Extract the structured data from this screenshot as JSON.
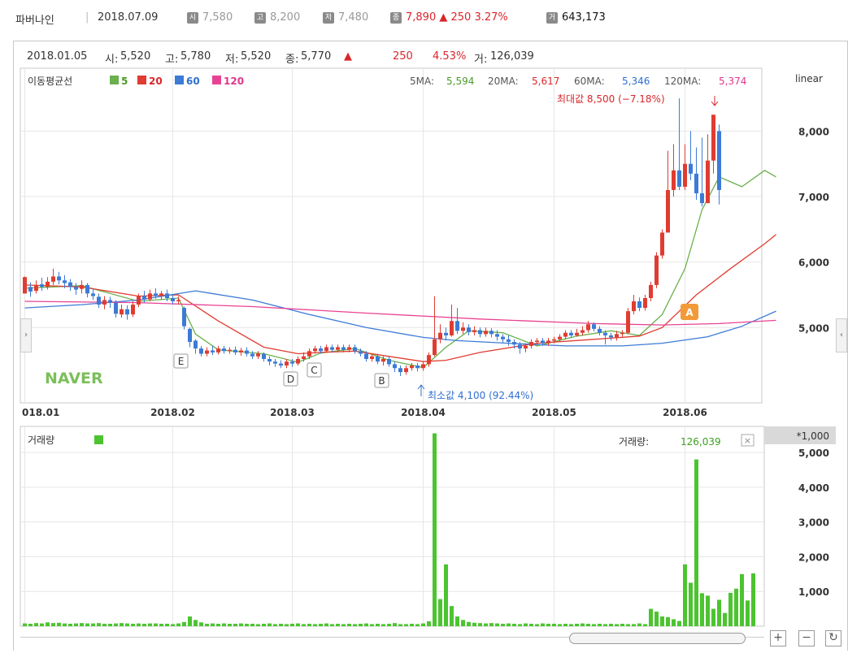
{
  "header": {
    "stock_name": "파버나인",
    "date": "2018.07.09",
    "open_badge": "시",
    "open_value": "7,580",
    "high_badge": "고",
    "high_value": "8,200",
    "low_badge": "저",
    "low_value": "7,480",
    "close_badge": "종",
    "close_value": "7,890",
    "change_value": "▲ 250",
    "change_rate": "3.27%",
    "volume_badge": "거",
    "volume_value": "643,173"
  },
  "info": {
    "date": "2018.01.05",
    "open_label": "시:",
    "open": "5,520",
    "high_label": "고:",
    "high": "5,780",
    "low_label": "저:",
    "low": "5,520",
    "close_label": "종:",
    "close": "5,770",
    "arrow": "▲",
    "change": "250",
    "rate": "4.53%",
    "volume_label": "거:",
    "volume": "126,039"
  },
  "ma_legend": {
    "title": "이동평균선",
    "items": [
      {
        "period": "5",
        "color": "#6ab04c"
      },
      {
        "period": "20",
        "color": "#e03c31"
      },
      {
        "period": "60",
        "color": "#3c7bd6"
      },
      {
        "period": "120",
        "color": "#e84393"
      }
    ]
  },
  "ma_values": [
    {
      "label": "5MA:",
      "value": "5,594",
      "color": "#4a9a2a"
    },
    {
      "label": "20MA:",
      "value": "5,617",
      "color": "#d9262b"
    },
    {
      "label": "60MA:",
      "value": "5,346",
      "color": "#2f6fd0"
    },
    {
      "label": "120MA:",
      "value": "5,374",
      "color": "#e0368a"
    }
  ],
  "scale_mode": "linear",
  "max_annotation": "최대값 8,500 (−7.18%)",
  "min_annotation": "최소값 4,100 (92.44%)",
  "watermark": "NAVER",
  "volume_panel": {
    "title": "거래량",
    "readout_label": "거래량:",
    "readout_value": "126,039",
    "unit_label": "*1,000",
    "close_icon": "×"
  },
  "event_markers": [
    "E",
    "D",
    "C",
    "B",
    "A"
  ],
  "chart_data": [
    {
      "type": "candlestick",
      "x_ticks": [
        "018.01",
        "2018.02",
        "2018.03",
        "2018.04",
        "2018.05",
        "2018.06"
      ],
      "y_ticks": [
        5000,
        6000,
        7000,
        8000
      ],
      "ylim": [
        3850,
        8960
      ],
      "colors": {
        "up": "#e03c31",
        "down": "#3c7bd6"
      },
      "candles": [
        [
          5520,
          5770,
          5780,
          5520
        ],
        [
          5620,
          5550,
          5690,
          5470
        ],
        [
          5560,
          5650,
          5720,
          5520
        ],
        [
          5660,
          5620,
          5760,
          5560
        ],
        [
          5620,
          5700,
          5770,
          5580
        ],
        [
          5700,
          5780,
          5900,
          5650
        ],
        [
          5780,
          5720,
          5850,
          5660
        ],
        [
          5720,
          5680,
          5800,
          5600
        ],
        [
          5690,
          5620,
          5740,
          5560
        ],
        [
          5620,
          5580,
          5680,
          5500
        ],
        [
          5590,
          5650,
          5720,
          5520
        ],
        [
          5650,
          5520,
          5680,
          5460
        ],
        [
          5520,
          5480,
          5600,
          5420
        ],
        [
          5470,
          5350,
          5520,
          5300
        ],
        [
          5350,
          5420,
          5480,
          5280
        ],
        [
          5420,
          5380,
          5470,
          5300
        ],
        [
          5380,
          5210,
          5420,
          5150
        ],
        [
          5200,
          5280,
          5350,
          5150
        ],
        [
          5280,
          5200,
          5340,
          5120
        ],
        [
          5200,
          5350,
          5400,
          5160
        ],
        [
          5350,
          5480,
          5520,
          5310
        ],
        [
          5480,
          5430,
          5560,
          5380
        ],
        [
          5430,
          5520,
          5580,
          5400
        ],
        [
          5520,
          5480,
          5600,
          5440
        ],
        [
          5480,
          5520,
          5560,
          5420
        ],
        [
          5520,
          5450,
          5580,
          5400
        ],
        [
          5450,
          5400,
          5500,
          5350
        ],
        [
          5400,
          5420,
          5480,
          5350
        ],
        [
          5300,
          5020,
          5320,
          4970
        ],
        [
          4980,
          4780,
          5000,
          4700
        ],
        [
          4800,
          4680,
          4820,
          4600
        ],
        [
          4680,
          4600,
          4720,
          4560
        ],
        [
          4600,
          4650,
          4700,
          4560
        ],
        [
          4650,
          4620,
          4720,
          4580
        ],
        [
          4620,
          4680,
          4720,
          4590
        ],
        [
          4680,
          4640,
          4720,
          4600
        ],
        [
          4640,
          4660,
          4700,
          4600
        ],
        [
          4660,
          4620,
          4710,
          4580
        ],
        [
          4620,
          4650,
          4690,
          4570
        ],
        [
          4650,
          4600,
          4700,
          4560
        ],
        [
          4600,
          4560,
          4640,
          4520
        ],
        [
          4560,
          4600,
          4640,
          4520
        ],
        [
          4600,
          4520,
          4620,
          4480
        ],
        [
          4520,
          4480,
          4560,
          4420
        ],
        [
          4480,
          4450,
          4520,
          4400
        ],
        [
          4450,
          4420,
          4500,
          4380
        ],
        [
          4420,
          4480,
          4520,
          4380
        ],
        [
          4480,
          4450,
          4520,
          4400
        ],
        [
          4450,
          4520,
          4560,
          4420
        ],
        [
          4520,
          4560,
          4620,
          4480
        ],
        [
          4560,
          4640,
          4680,
          4520
        ],
        [
          4640,
          4680,
          4720,
          4600
        ],
        [
          4680,
          4640,
          4720,
          4600
        ],
        [
          4640,
          4700,
          4740,
          4620
        ],
        [
          4700,
          4660,
          4740,
          4620
        ],
        [
          4660,
          4700,
          4740,
          4640
        ],
        [
          4700,
          4660,
          4740,
          4620
        ],
        [
          4660,
          4700,
          4740,
          4620
        ],
        [
          4700,
          4640,
          4740,
          4600
        ],
        [
          4640,
          4600,
          4680,
          4560
        ],
        [
          4600,
          4520,
          4640,
          4480
        ],
        [
          4520,
          4560,
          4600,
          4480
        ],
        [
          4560,
          4480,
          4600,
          4440
        ],
        [
          4480,
          4520,
          4560,
          4420
        ],
        [
          4520,
          4440,
          4560,
          4400
        ],
        [
          4440,
          4380,
          4480,
          4320
        ],
        [
          4380,
          4320,
          4420,
          4260
        ],
        [
          4320,
          4380,
          4420,
          4280
        ],
        [
          4380,
          4420,
          4460,
          4340
        ],
        [
          4420,
          4380,
          4460,
          4330
        ],
        [
          4380,
          4440,
          4480,
          4340
        ],
        [
          4440,
          4580,
          4620,
          4400
        ],
        [
          4580,
          4820,
          5480,
          4560
        ],
        [
          4820,
          4920,
          5050,
          4760
        ],
        [
          4920,
          4880,
          5000,
          4800
        ],
        [
          4880,
          5100,
          5350,
          4860
        ],
        [
          5100,
          4950,
          5300,
          4900
        ],
        [
          4950,
          5000,
          5080,
          4900
        ],
        [
          5000,
          4930,
          5050,
          4880
        ],
        [
          4930,
          4960,
          5020,
          4880
        ],
        [
          4960,
          4900,
          5000,
          4850
        ],
        [
          4900,
          4950,
          5000,
          4860
        ],
        [
          4950,
          4900,
          4990,
          4850
        ],
        [
          4900,
          4860,
          4960,
          4800
        ],
        [
          4860,
          4820,
          4900,
          4770
        ],
        [
          4820,
          4780,
          4880,
          4720
        ],
        [
          4780,
          4740,
          4820,
          4680
        ],
        [
          4740,
          4680,
          4780,
          4600
        ],
        [
          4680,
          4720,
          4760,
          4620
        ],
        [
          4720,
          4780,
          4820,
          4680
        ],
        [
          4780,
          4800,
          4840,
          4740
        ],
        [
          4800,
          4760,
          4840,
          4720
        ],
        [
          4760,
          4800,
          4840,
          4720
        ],
        [
          4800,
          4820,
          4860,
          4760
        ],
        [
          4820,
          4860,
          4900,
          4780
        ],
        [
          4860,
          4920,
          4960,
          4820
        ],
        [
          4920,
          4880,
          4960,
          4840
        ],
        [
          4880,
          4920,
          4980,
          4860
        ],
        [
          4920,
          4960,
          5020,
          4880
        ],
        [
          4960,
          5050,
          5100,
          4920
        ],
        [
          5050,
          4980,
          5080,
          4940
        ],
        [
          4980,
          4920,
          5020,
          4880
        ],
        [
          4920,
          4880,
          4960,
          4740
        ],
        [
          4880,
          4850,
          4920,
          4800
        ],
        [
          4850,
          4900,
          4950,
          4800
        ],
        [
          4900,
          4920,
          4960,
          4860
        ],
        [
          4920,
          5250,
          5300,
          4900
        ],
        [
          5250,
          5400,
          5500,
          5200
        ],
        [
          5400,
          5300,
          5460,
          5250
        ],
        [
          5300,
          5450,
          5500,
          5260
        ],
        [
          5450,
          5650,
          5700,
          5400
        ],
        [
          5650,
          6100,
          6150,
          5600
        ],
        [
          6100,
          6450,
          6500,
          6050
        ],
        [
          6450,
          7100,
          7700,
          6950
        ],
        [
          7100,
          7400,
          7800,
          7000
        ],
        [
          7400,
          7150,
          8500,
          7100
        ],
        [
          7150,
          7500,
          7800,
          7100
        ],
        [
          7500,
          7350,
          8000,
          7250
        ],
        [
          7350,
          7050,
          7750,
          6950
        ],
        [
          7050,
          6900,
          7900,
          6850
        ],
        [
          6900,
          7550,
          7950,
          6900
        ],
        [
          7550,
          8250,
          8250,
          7350
        ],
        [
          8000,
          7100,
          8100,
          6880
        ]
      ],
      "ma_lines": [
        {
          "name": "5",
          "color": "#6ab04c",
          "points": [
            [
              0,
              5600
            ],
            [
              10,
              5640
            ],
            [
              20,
              5400
            ],
            [
              27,
              5450
            ],
            [
              30,
              4900
            ],
            [
              34,
              4660
            ],
            [
              42,
              4600
            ],
            [
              48,
              4470
            ],
            [
              52,
              4610
            ],
            [
              58,
              4680
            ],
            [
              64,
              4500
            ],
            [
              70,
              4390
            ],
            [
              74,
              4700
            ],
            [
              78,
              4950
            ],
            [
              84,
              4920
            ],
            [
              90,
              4720
            ],
            [
              97,
              4870
            ],
            [
              103,
              4950
            ],
            [
              108,
              4880
            ],
            [
              112,
              5200
            ],
            [
              116,
              5900
            ],
            [
              119,
              6800
            ],
            [
              122,
              7300
            ],
            [
              126,
              7150
            ],
            [
              130,
              7400
            ],
            [
              132,
              7300
            ]
          ]
        },
        {
          "name": "20",
          "color": "#e03c31",
          "points": [
            [
              0,
              5650
            ],
            [
              10,
              5620
            ],
            [
              20,
              5480
            ],
            [
              27,
              5500
            ],
            [
              34,
              5100
            ],
            [
              42,
              4700
            ],
            [
              48,
              4600
            ],
            [
              52,
              4620
            ],
            [
              58,
              4640
            ],
            [
              64,
              4560
            ],
            [
              70,
              4480
            ],
            [
              74,
              4500
            ],
            [
              80,
              4620
            ],
            [
              90,
              4760
            ],
            [
              100,
              4820
            ],
            [
              108,
              4870
            ],
            [
              112,
              5000
            ],
            [
              118,
              5500
            ],
            [
              124,
              5900
            ],
            [
              130,
              6280
            ],
            [
              132,
              6420
            ]
          ]
        },
        {
          "name": "60",
          "color": "#3c7bd6",
          "points": [
            [
              0,
              5300
            ],
            [
              10,
              5350
            ],
            [
              20,
              5420
            ],
            [
              30,
              5560
            ],
            [
              40,
              5420
            ],
            [
              50,
              5200
            ],
            [
              60,
              5000
            ],
            [
              70,
              4850
            ],
            [
              76,
              4800
            ],
            [
              85,
              4760
            ],
            [
              95,
              4720
            ],
            [
              105,
              4720
            ],
            [
              112,
              4760
            ],
            [
              120,
              4860
            ],
            [
              126,
              5020
            ],
            [
              132,
              5250
            ]
          ]
        },
        {
          "name": "120",
          "color": "#e84393",
          "points": [
            [
              0,
              5400
            ],
            [
              20,
              5380
            ],
            [
              40,
              5320
            ],
            [
              60,
              5220
            ],
            [
              80,
              5130
            ],
            [
              100,
              5060
            ],
            [
              112,
              5040
            ],
            [
              122,
              5060
            ],
            [
              132,
              5110
            ]
          ]
        }
      ]
    },
    {
      "type": "bar",
      "title": "거래량",
      "unit": "*1,000",
      "y_ticks": [
        1000,
        2000,
        3000,
        4000,
        5000
      ],
      "ylim": [
        0,
        5750
      ],
      "values": [
        80,
        70,
        90,
        80,
        110,
        90,
        100,
        80,
        70,
        80,
        90,
        80,
        80,
        90,
        70,
        70,
        80,
        90,
        80,
        70,
        80,
        70,
        80,
        80,
        70,
        70,
        60,
        80,
        120,
        280,
        180,
        110,
        70,
        80,
        70,
        80,
        70,
        70,
        80,
        70,
        70,
        60,
        70,
        80,
        60,
        70,
        60,
        70,
        80,
        60,
        70,
        60,
        70,
        80,
        60,
        70,
        60,
        70,
        60,
        70,
        80,
        60,
        70,
        60,
        70,
        90,
        60,
        60,
        70,
        60,
        80,
        140,
        5550,
        780,
        1780,
        580,
        280,
        180,
        120,
        100,
        90,
        80,
        90,
        80,
        70,
        80,
        70,
        60,
        80,
        70,
        60,
        80,
        70,
        70,
        60,
        70,
        60,
        70,
        80,
        70,
        60,
        70,
        60,
        70,
        60,
        70,
        60,
        60,
        80,
        60,
        500,
        420,
        280,
        260,
        200,
        150,
        1780,
        1250,
        4800,
        950,
        880,
        500,
        760,
        380,
        960,
        1080,
        1500,
        740,
        1520
      ],
      "color": "#4cc430"
    }
  ]
}
